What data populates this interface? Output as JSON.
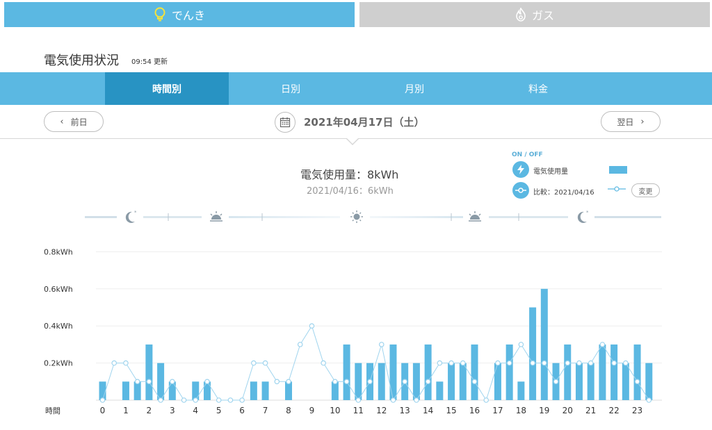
{
  "tabs": {
    "electric": {
      "label": "でんき"
    },
    "gas": {
      "label": "ガス"
    }
  },
  "header": {
    "title": "電気使用状況",
    "update_time": "09:54 更新"
  },
  "period_tabs": [
    {
      "label": "時間別",
      "active": true
    },
    {
      "label": "日別",
      "active": false
    },
    {
      "label": "月別",
      "active": false
    },
    {
      "label": "料金",
      "active": false
    }
  ],
  "date_nav": {
    "prev_label": "前日",
    "next_label": "翌日",
    "date": "2021年04月17日（土）"
  },
  "usage": {
    "main": "電気使用量：8kWh",
    "compare": "2021/04/16：6kWh"
  },
  "legend": {
    "onoff": "ON / OFF",
    "usage_label": "電気使用量",
    "compare_label": "比較：2021/04/16",
    "change_label": "変更"
  },
  "colors": {
    "accent": "#5bb8e2",
    "accent_dark": "#2893c3",
    "gas_tab": "#cfcfcf",
    "bar": "#5bb8e2",
    "line": "#9fd4ee",
    "icon_bulb": "#f5e33c"
  },
  "chart_data": {
    "type": "bar",
    "xlabel": "時間",
    "ylim": [
      0,
      0.8
    ],
    "yticks": [
      "0.2kWh",
      "0.4kWh",
      "0.6kWh",
      "0.8kWh"
    ],
    "ytick_values": [
      0.2,
      0.4,
      0.6,
      0.8
    ],
    "x_labels": [
      "0",
      "1",
      "2",
      "3",
      "4",
      "5",
      "6",
      "7",
      "8",
      "9",
      "10",
      "11",
      "12",
      "13",
      "14",
      "15",
      "16",
      "17",
      "18",
      "19",
      "20",
      "21",
      "22",
      "23"
    ],
    "series": [
      {
        "type": "bar",
        "values": [
          0.1,
          0,
          0.1,
          0.1,
          0.3,
          0.2,
          0.1,
          0,
          0.1,
          0.1,
          0,
          0,
          0,
          0.1,
          0.1,
          0,
          0.1,
          0,
          0,
          0,
          0.1,
          0.3,
          0.2,
          0.2,
          0.2,
          0.3,
          0.2,
          0.2,
          0.3,
          0.1,
          0.2,
          0.2,
          0.3,
          0,
          0.2,
          0.3,
          0.1,
          0.5,
          0.6,
          0.2,
          0.3,
          0.2,
          0.2,
          0.3,
          0.3,
          0.2,
          0.3,
          0.2
        ]
      },
      {
        "type": "line",
        "values": [
          0,
          0.2,
          0.2,
          0.1,
          0.1,
          0,
          0.1,
          0,
          0,
          0.1,
          0,
          0,
          0,
          0.2,
          0.2,
          0.1,
          0.1,
          0.3,
          0.4,
          0.2,
          0.1,
          0.1,
          0,
          0.1,
          0.3,
          0,
          0.1,
          0,
          0.1,
          0.2,
          0.2,
          0.2,
          0.1,
          0,
          0.2,
          0.2,
          0.3,
          0.2,
          0.2,
          0.1,
          0.2,
          0.2,
          0.2,
          0.3,
          0.2,
          0.2,
          0.1,
          0
        ]
      }
    ]
  }
}
